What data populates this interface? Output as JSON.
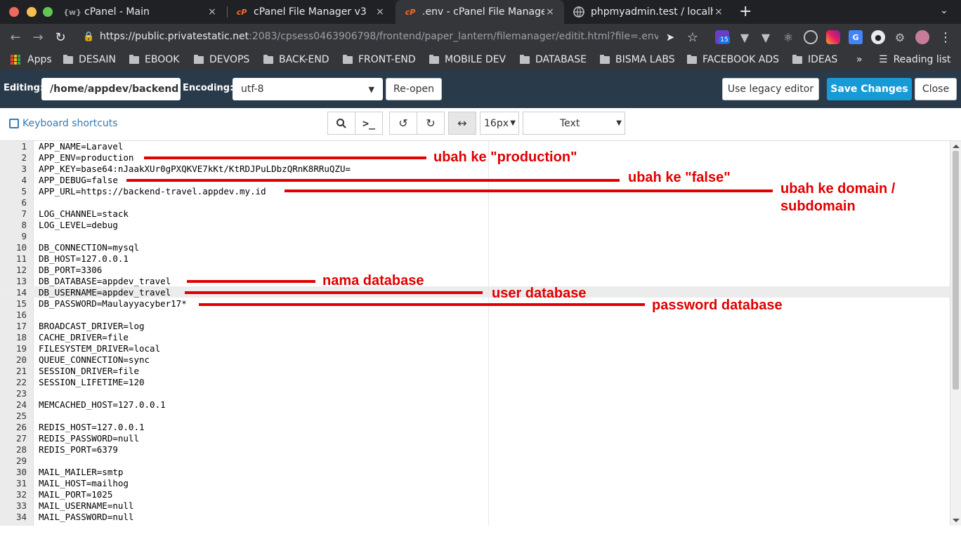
{
  "tabs": [
    {
      "icon": "{w}",
      "title": "cPanel - Main",
      "close": "×"
    },
    {
      "icon": "cP",
      "title": "cPanel File Manager v3",
      "close": "×"
    },
    {
      "icon": "cP",
      "title": ".env - cPanel File Manager",
      "close": "×"
    },
    {
      "icon": "globe",
      "title": "phpmyadmin.test / localh",
      "close": "×"
    }
  ],
  "new_tab": "+",
  "address": {
    "url_host": "https://public.privatestatic.net",
    "url_path": ":2083/cpsess0463906798/frontend/paper_lantern/filemanager/editit.html?file=.env&fileop=..."
  },
  "extensions": {
    "badge_count": "15"
  },
  "bookmarks": {
    "apps": "Apps",
    "folders": [
      "DESAIN",
      "EBOOK",
      "DEVOPS",
      "BACK-END",
      "FRONT-END",
      "MOBILE DEV",
      "DATABASE",
      "BISMA LABS",
      "FACEBOOK ADS",
      "IDEAS"
    ],
    "more": "»",
    "reading_list": "Reading list"
  },
  "editor_bar": {
    "editing_label": "Editing:",
    "editing_path": "/home/appdev/backend",
    "encoding_label": "Encoding:",
    "encoding_value": "utf-8",
    "reopen": "Re-open",
    "legacy": "Use legacy editor",
    "save": "Save Changes",
    "close": "Close"
  },
  "subbar": {
    "keyboard_shortcuts": "Keyboard shortcuts",
    "font_size": "16px",
    "mode": "Text"
  },
  "file_lines": [
    "APP_NAME=Laravel",
    "APP_ENV=production",
    "APP_KEY=base64:nJaakXUr0gPXQKVE7kKt/KtRDJPuLDbzQRnK8RRuQZU=",
    "APP_DEBUG=false",
    "APP_URL=https://backend-travel.appdev.my.id",
    "",
    "LOG_CHANNEL=stack",
    "LOG_LEVEL=debug",
    "",
    "DB_CONNECTION=mysql",
    "DB_HOST=127.0.0.1",
    "DB_PORT=3306",
    "DB_DATABASE=appdev_travel",
    "DB_USERNAME=appdev_travel",
    "DB_PASSWORD=Maulayyacyber17*",
    "",
    "BROADCAST_DRIVER=log",
    "CACHE_DRIVER=file",
    "FILESYSTEM_DRIVER=local",
    "QUEUE_CONNECTION=sync",
    "SESSION_DRIVER=file",
    "SESSION_LIFETIME=120",
    "",
    "MEMCACHED_HOST=127.0.0.1",
    "",
    "REDIS_HOST=127.0.0.1",
    "REDIS_PASSWORD=null",
    "REDIS_PORT=6379",
    "",
    "MAIL_MAILER=smtp",
    "MAIL_HOST=mailhog",
    "MAIL_PORT=1025",
    "MAIL_USERNAME=null",
    "MAIL_PASSWORD=null"
  ],
  "annotations": {
    "production": "ubah ke \"production\"",
    "false": "ubah ke \"false\"",
    "domain_1": "ubah ke domain /",
    "domain_2": "subdomain",
    "db_name": "nama database",
    "db_user": "user database",
    "db_pass": "password database"
  },
  "colors": {
    "annotation": "#e00000",
    "save_button": "#179bd7",
    "editor_bar": "#293a4a"
  }
}
